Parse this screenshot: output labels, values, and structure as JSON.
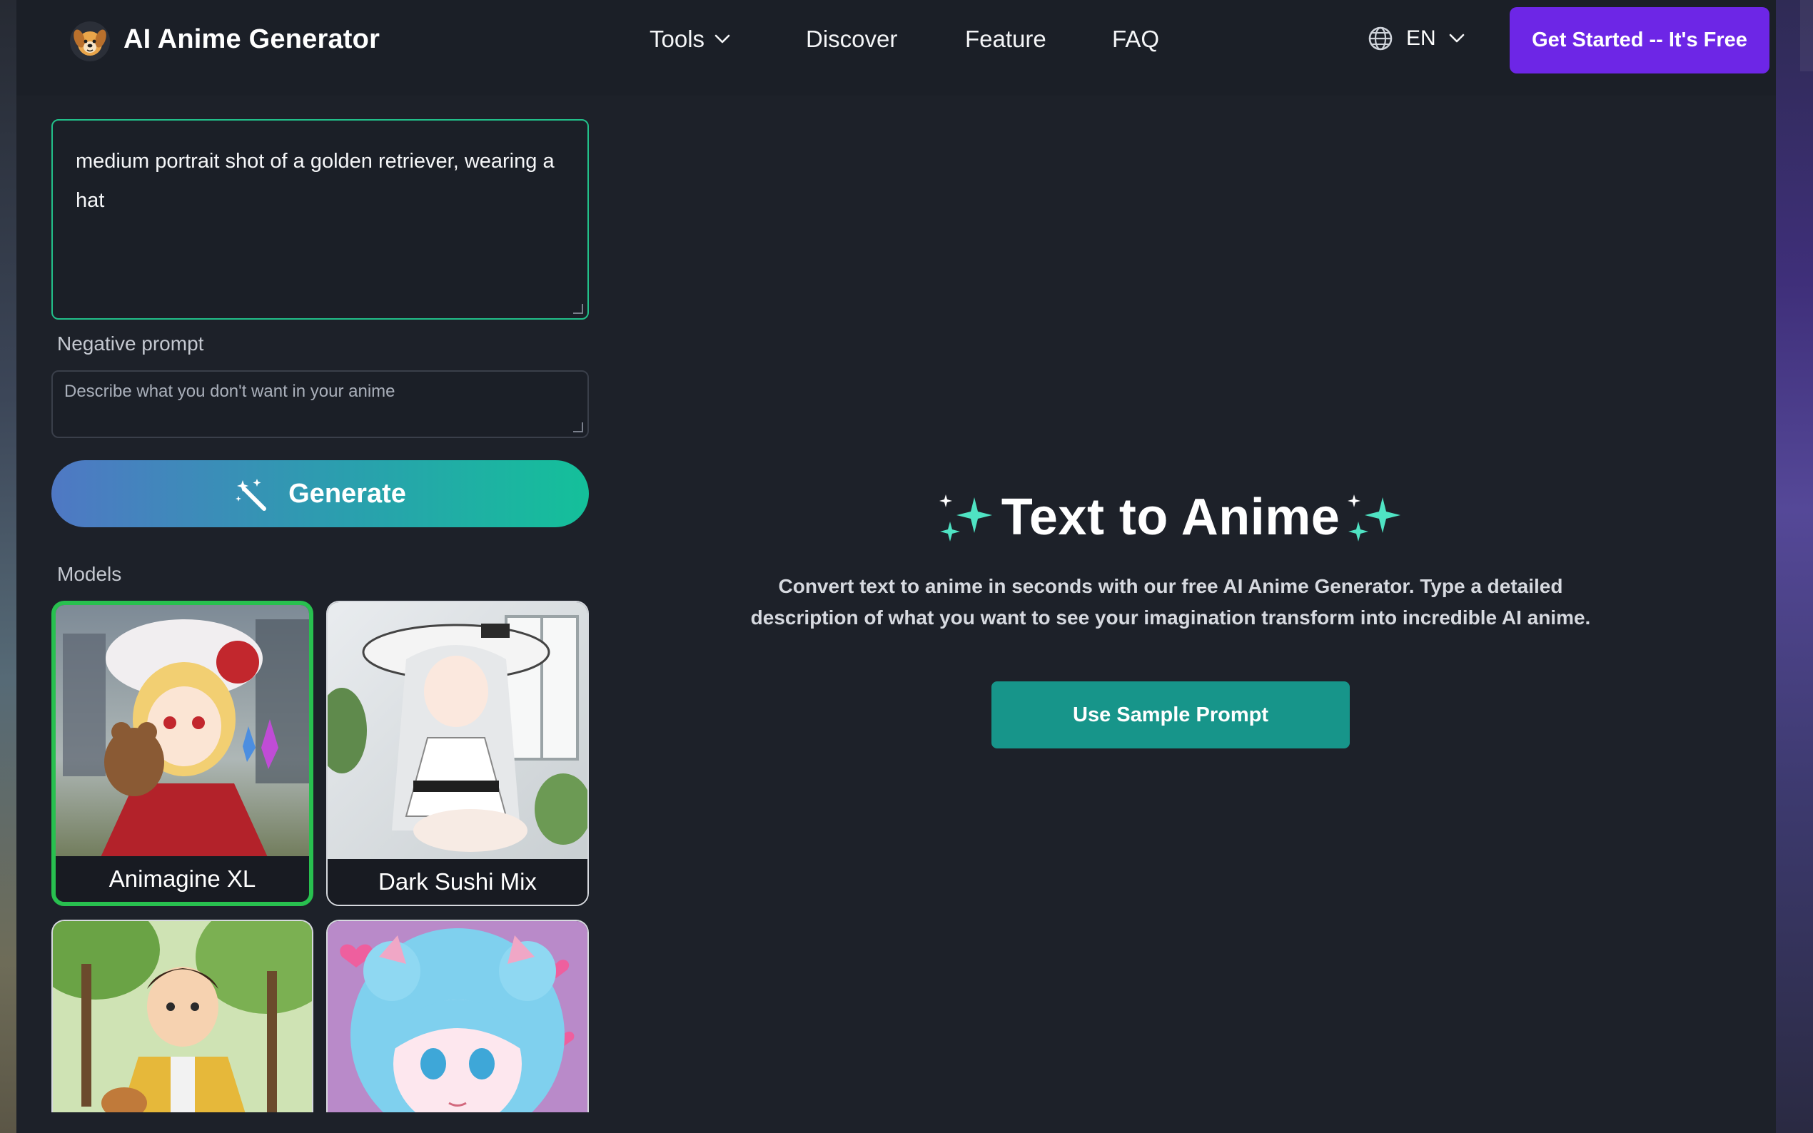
{
  "header": {
    "brand": "AI Anime Generator",
    "nav": [
      {
        "label": "Tools",
        "has_dropdown": true
      },
      {
        "label": "Discover"
      },
      {
        "label": "Feature"
      },
      {
        "label": "FAQ"
      }
    ],
    "language": "EN",
    "cta_label": "Get Started -- It's Free"
  },
  "prompt": {
    "value": "medium portrait shot of a golden retriever, wearing a hat"
  },
  "negative_prompt": {
    "label": "Negative prompt",
    "placeholder": "Describe what you don't want in your anime"
  },
  "generate_label": "Generate",
  "models": {
    "label": "Models",
    "items": [
      {
        "name": "Animagine XL",
        "selected": true
      },
      {
        "name": "Dark Sushi Mix",
        "selected": false
      },
      {
        "name": "",
        "selected": false
      },
      {
        "name": "",
        "selected": false
      }
    ]
  },
  "hero": {
    "title": "Text to Anime",
    "description": "Convert text to anime in seconds with our free AI Anime Generator. Type a detailed description of what you want to see your imagination transform into incredible AI anime.",
    "sample_button": "Use Sample Prompt"
  },
  "colors": {
    "accent_purple": "#6d26e6",
    "accent_green": "#22c08a",
    "sample_teal": "#17958a",
    "sparkle": "#4fe3c3"
  },
  "icons": {
    "logo": "dog-face-icon",
    "tools_chevron": "chevron-down-icon",
    "language": "globe-icon",
    "language_chevron": "chevron-down-icon",
    "generate": "magic-wand-icon",
    "title_sparkles": "sparkles-icon"
  }
}
